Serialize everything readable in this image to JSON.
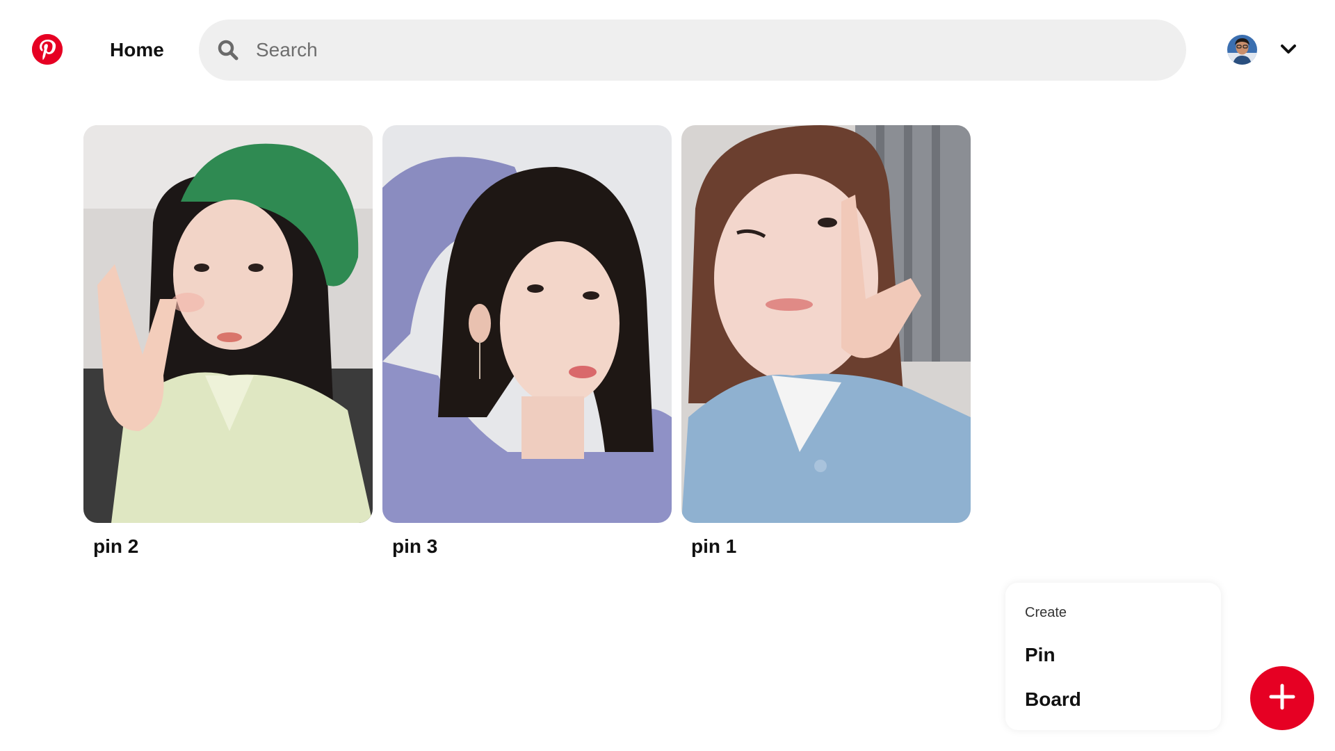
{
  "header": {
    "logo_icon": "pinterest-logo-icon",
    "home_label": "Home",
    "search_placeholder": "Search",
    "search_value": "",
    "search_icon": "search-icon",
    "avatar_icon": "user-avatar",
    "menu_icon": "chevron-down-icon"
  },
  "pins": [
    {
      "title": "pin 2"
    },
    {
      "title": "pin 3"
    },
    {
      "title": "pin 1"
    }
  ],
  "create_menu": {
    "heading": "Create",
    "items": [
      {
        "label": "Pin"
      },
      {
        "label": "Board"
      }
    ]
  },
  "fab_icon": "plus-icon",
  "colors": {
    "brand": "#e60023",
    "search_bg": "#efefef",
    "text": "#111111"
  }
}
